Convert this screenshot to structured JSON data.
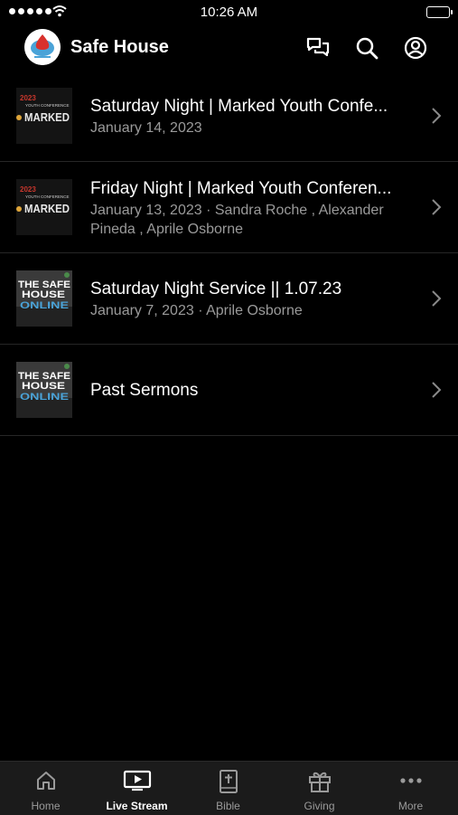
{
  "status": {
    "time": "10:26 AM"
  },
  "header": {
    "title": "Safe House"
  },
  "items": [
    {
      "title": "Saturday Night | Marked Youth Confe...",
      "subtitle": "January 14, 2023",
      "thumb_year": "2023",
      "thumb_small": "YOUTH CONFERENCE",
      "thumb_big": "MARKED"
    },
    {
      "title": "Friday Night | Marked Youth Conferen...",
      "subtitle": "January 13, 2023 · Sandra Roche , Alexander Pineda , Aprile Osborne",
      "thumb_year": "2023",
      "thumb_small": "YOUTH CONFERENCE",
      "thumb_big": "MARKED"
    },
    {
      "title": "Saturday Night Service ||  1.07.23",
      "subtitle": "January 7, 2023 · Aprile Osborne",
      "thumb_l1": "THE SAFE",
      "thumb_l2": "HOUSE",
      "thumb_l3": "ONLINE"
    },
    {
      "title": "Past Sermons",
      "thumb_l1": "THE SAFE",
      "thumb_l2": "HOUSE",
      "thumb_l3": "ONLINE"
    }
  ],
  "tabs": [
    {
      "label": "Home",
      "icon": "home-icon"
    },
    {
      "label": "Live Stream",
      "icon": "tv-play-icon"
    },
    {
      "label": "Bible",
      "icon": "bible-icon"
    },
    {
      "label": "Giving",
      "icon": "gift-icon"
    },
    {
      "label": "More",
      "icon": "more-icon"
    }
  ],
  "active_tab": "Live Stream",
  "colors": {
    "background": "#000000",
    "tab_bar": "#1b1b1b",
    "subtitle": "#9a9a9a",
    "divider": "#262626",
    "accent_blue": "#4aa3d8",
    "marked_red": "#c8372d"
  }
}
